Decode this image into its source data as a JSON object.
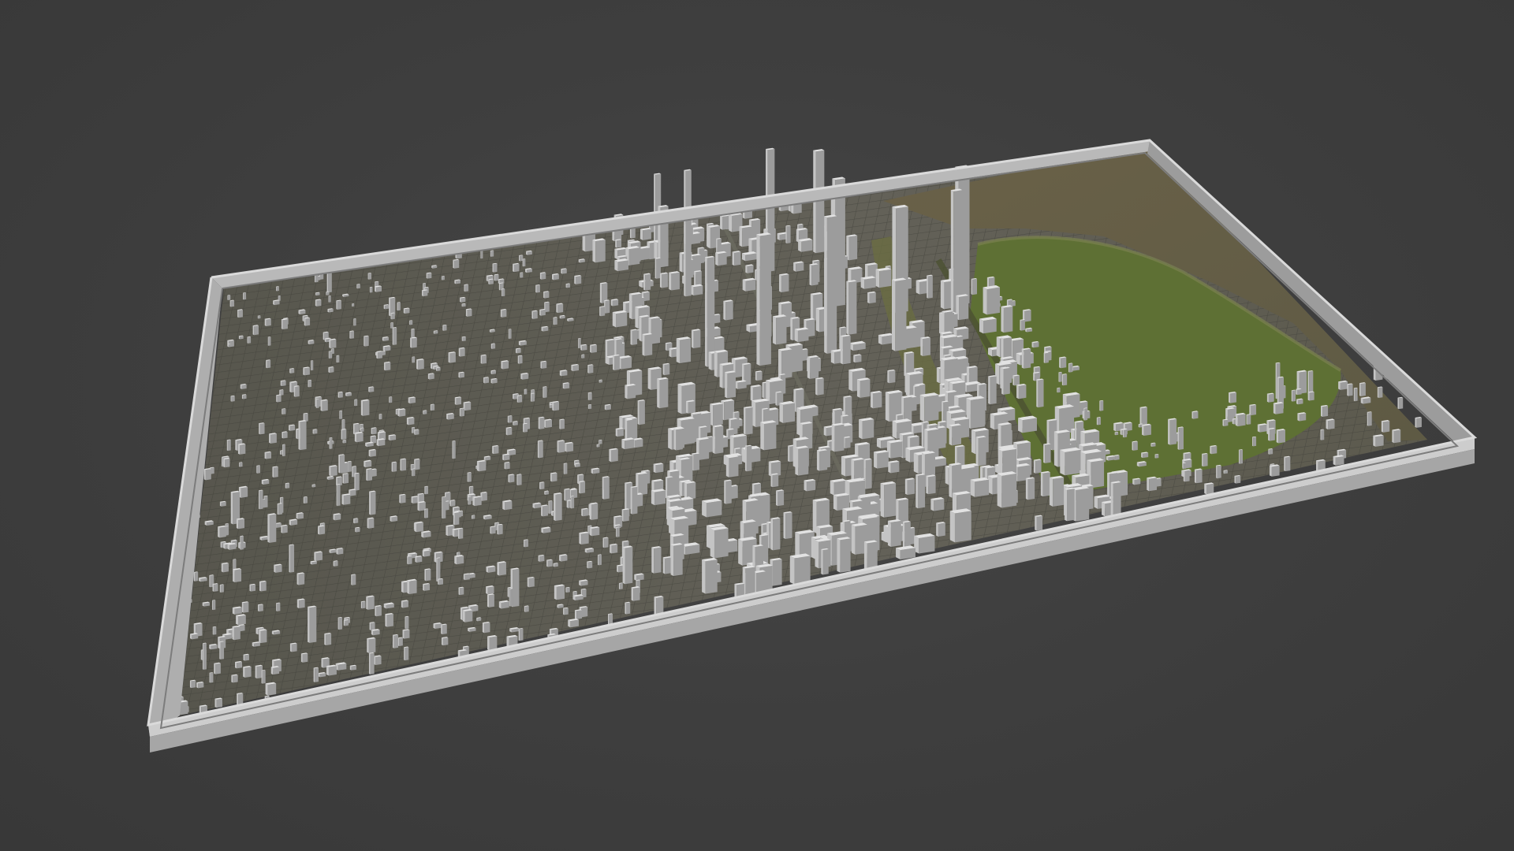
{
  "scene": {
    "subject": "3d-city-model",
    "colors": {
      "background": "#3d3d3d",
      "frame_top": "#c8c8c8",
      "frame_outer": "#b2b2b2",
      "frame_inner": "#8d8d8d",
      "buildings_light": "#dcdcdc",
      "buildings_shadow": "#9a9a9a",
      "ground_urban": "#5b5a4f",
      "ground_park": "#5e7034",
      "water": "#6f6447"
    }
  }
}
